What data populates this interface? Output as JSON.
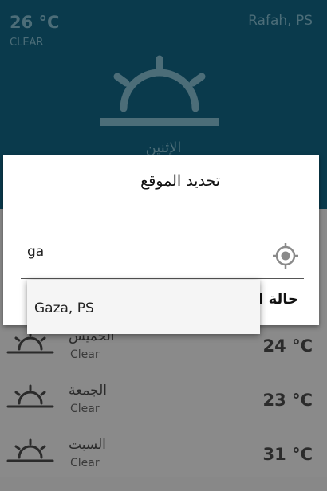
{
  "header": {
    "temp": "26 °C",
    "condition": "CLEAR",
    "city": "Rafah, PS",
    "day": "الإثنين"
  },
  "forecast": [
    {
      "day": "الخميس",
      "desc": "Clear",
      "temp": "24 °C"
    },
    {
      "day": "الجمعة",
      "desc": "Clear",
      "temp": "23 °C"
    },
    {
      "day": "السبت",
      "desc": "Clear",
      "temp": "31 °C"
    }
  ],
  "dialog": {
    "title": "تحديد الموقع",
    "input_value": "ga",
    "partial_label": "حالة ا",
    "suggestion": "Gaza, PS"
  },
  "colors": {
    "header_bg": "#0a3a4c",
    "dim_text": "#4c6d78",
    "list_bg": "#8a8a8a"
  },
  "icons": {
    "weather": "sun-rise-icon",
    "location": "crosshair-location-icon"
  }
}
